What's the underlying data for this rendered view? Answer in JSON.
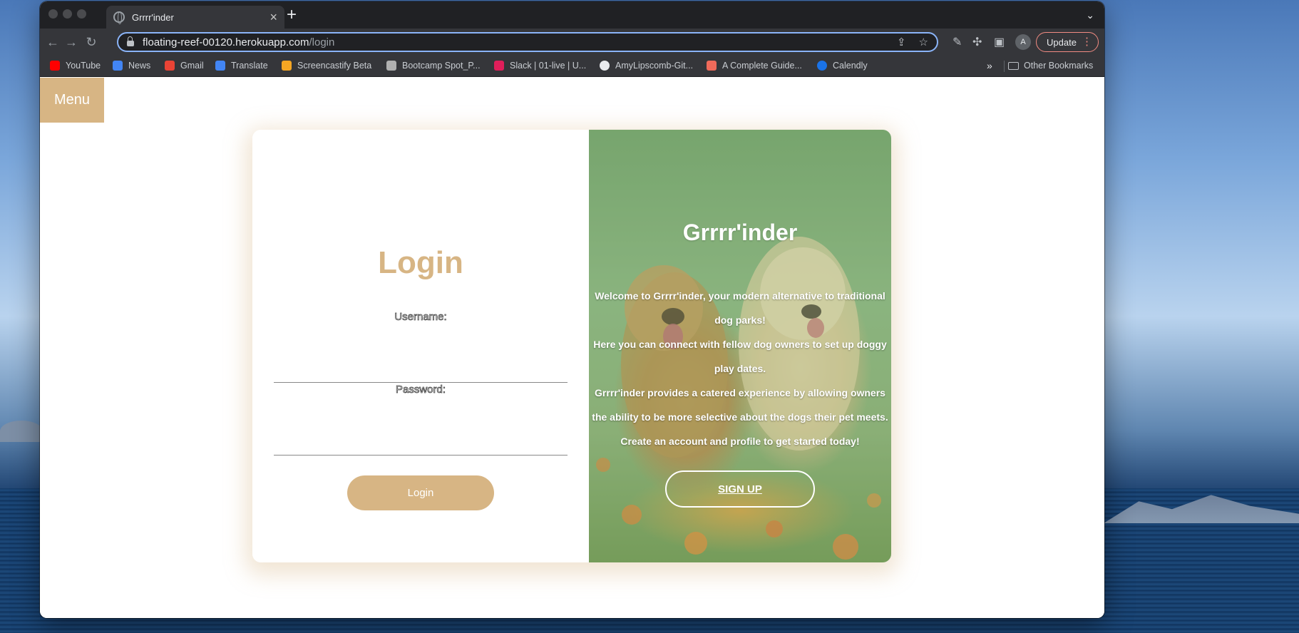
{
  "browser": {
    "tab_title": "Grrrr'inder",
    "url_host": "floating-reef-00120.herokuapp.com",
    "url_path": "/login",
    "avatar_initial": "A",
    "update_label": "Update",
    "bookmarks": [
      {
        "label": "YouTube",
        "icon": "youtube-icon",
        "color": "#ff0000"
      },
      {
        "label": "News",
        "icon": "news-icon",
        "color": "#4285f4"
      },
      {
        "label": "Gmail",
        "icon": "gmail-icon",
        "color": "#ea4335"
      },
      {
        "label": "Translate",
        "icon": "translate-icon",
        "color": "#4285f4"
      },
      {
        "label": "Screencastify Beta",
        "icon": "screencastify-icon",
        "color": "#f5a623"
      },
      {
        "label": "Bootcamp Spot_P...",
        "icon": "bootcamp-icon",
        "color": "#b0b0b0"
      },
      {
        "label": "Slack | 01-live | U...",
        "icon": "slack-icon",
        "color": "#e01e5a"
      },
      {
        "label": "AmyLipscomb-Git...",
        "icon": "github-icon",
        "color": "#e8eaed"
      },
      {
        "label": "A Complete Guide...",
        "icon": "guide-icon",
        "color": "#f06a5a"
      },
      {
        "label": "Calendly",
        "icon": "calendly-icon",
        "color": "#1a73e8"
      }
    ],
    "other_bookmarks": "Other Bookmarks"
  },
  "page": {
    "menu_label": "Menu",
    "login": {
      "title": "Login",
      "username_label": "Username:",
      "username_value": "",
      "password_label": "Password:",
      "password_value": "",
      "button_label": "Login"
    },
    "promo": {
      "title": "Grrrr'inder",
      "line1": "Welcome to Grrrr'inder, your modern alternative to traditional dog parks!",
      "line2": "Here you can connect with fellow dog owners to set up doggy play dates.",
      "line3": "Grrrr'inder provides a catered experience by allowing owners the ability to be more selective about the dogs their pet meets.",
      "line4": "Create an account and profile to get started today!",
      "signup_label": "SIGN UP"
    }
  },
  "colors": {
    "accent": "#d7b584",
    "browser_dark": "#35363a"
  }
}
